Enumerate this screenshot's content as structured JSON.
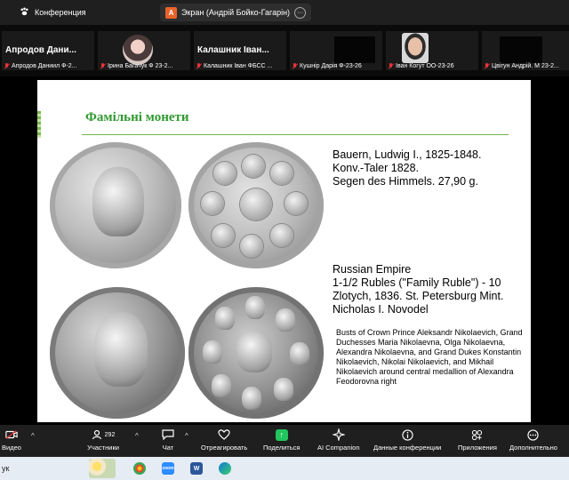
{
  "topbar": {
    "conference_label": "Конференция",
    "share_badge": "A",
    "share_title": "Экран (Андрій Бойко-Гагарін)",
    "share_more": "···"
  },
  "participants": [
    {
      "big": "Апродов Дани...",
      "label": "Апродов Даниил Ф-2..."
    },
    {
      "big": "",
      "label": "Ірина Багачук Ф 23-2..."
    },
    {
      "big": "Калашник Іван...",
      "label": "Калашник Іван ФБСС ..."
    },
    {
      "big": "",
      "label": "Кушнір Дарія Ф-23-26"
    },
    {
      "big": "",
      "label": "Іван Когут ОО-23-26"
    },
    {
      "big": "",
      "label": "Цвігун Андрій. М 23-2..."
    }
  ],
  "slide": {
    "title": "Фамільні монети",
    "coin1_lines": [
      "Bauern, Ludwig I., 1825-1848.",
      "Konv.-Taler 1828.",
      "Segen des Himmels. 27,90 g."
    ],
    "coin2_lines": [
      "Russian Empire",
      "1-1/2 Rubles (\"Family Ruble\") - 10",
      "Zlotych, 1836. St. Petersburg Mint.",
      "Nicholas I. Novodel"
    ],
    "coin2_desc": "Busts of Crown Prince Aleksandr Nikolaevich, Grand Duchesses Maria Nikolaevna, Olga Nikolaevna, Alexandra Nikolaevna, and Grand Dukes Konstantin Nikolaevich, Nikolai Nikolaevich, and Mikhail Nikolaevich around central medallion of Alexandra Feodorovna right"
  },
  "toolbar": {
    "video": "Видео",
    "participants": "Участники",
    "participants_count": "292",
    "chat": "Чат",
    "react": "Отреагировать",
    "share": "Поделиться",
    "ai": "AI Companion",
    "data": "Данные конференции",
    "apps": "Приложения",
    "more": "Дополнительно",
    "caret": "^"
  },
  "taskbar": {
    "left_text": "ук",
    "word_label": "W",
    "zoom_label": "zoom"
  },
  "colors": {
    "accent_green": "#2f9a2f",
    "share_green": "#22c55e",
    "muted_red": "#e33333"
  }
}
